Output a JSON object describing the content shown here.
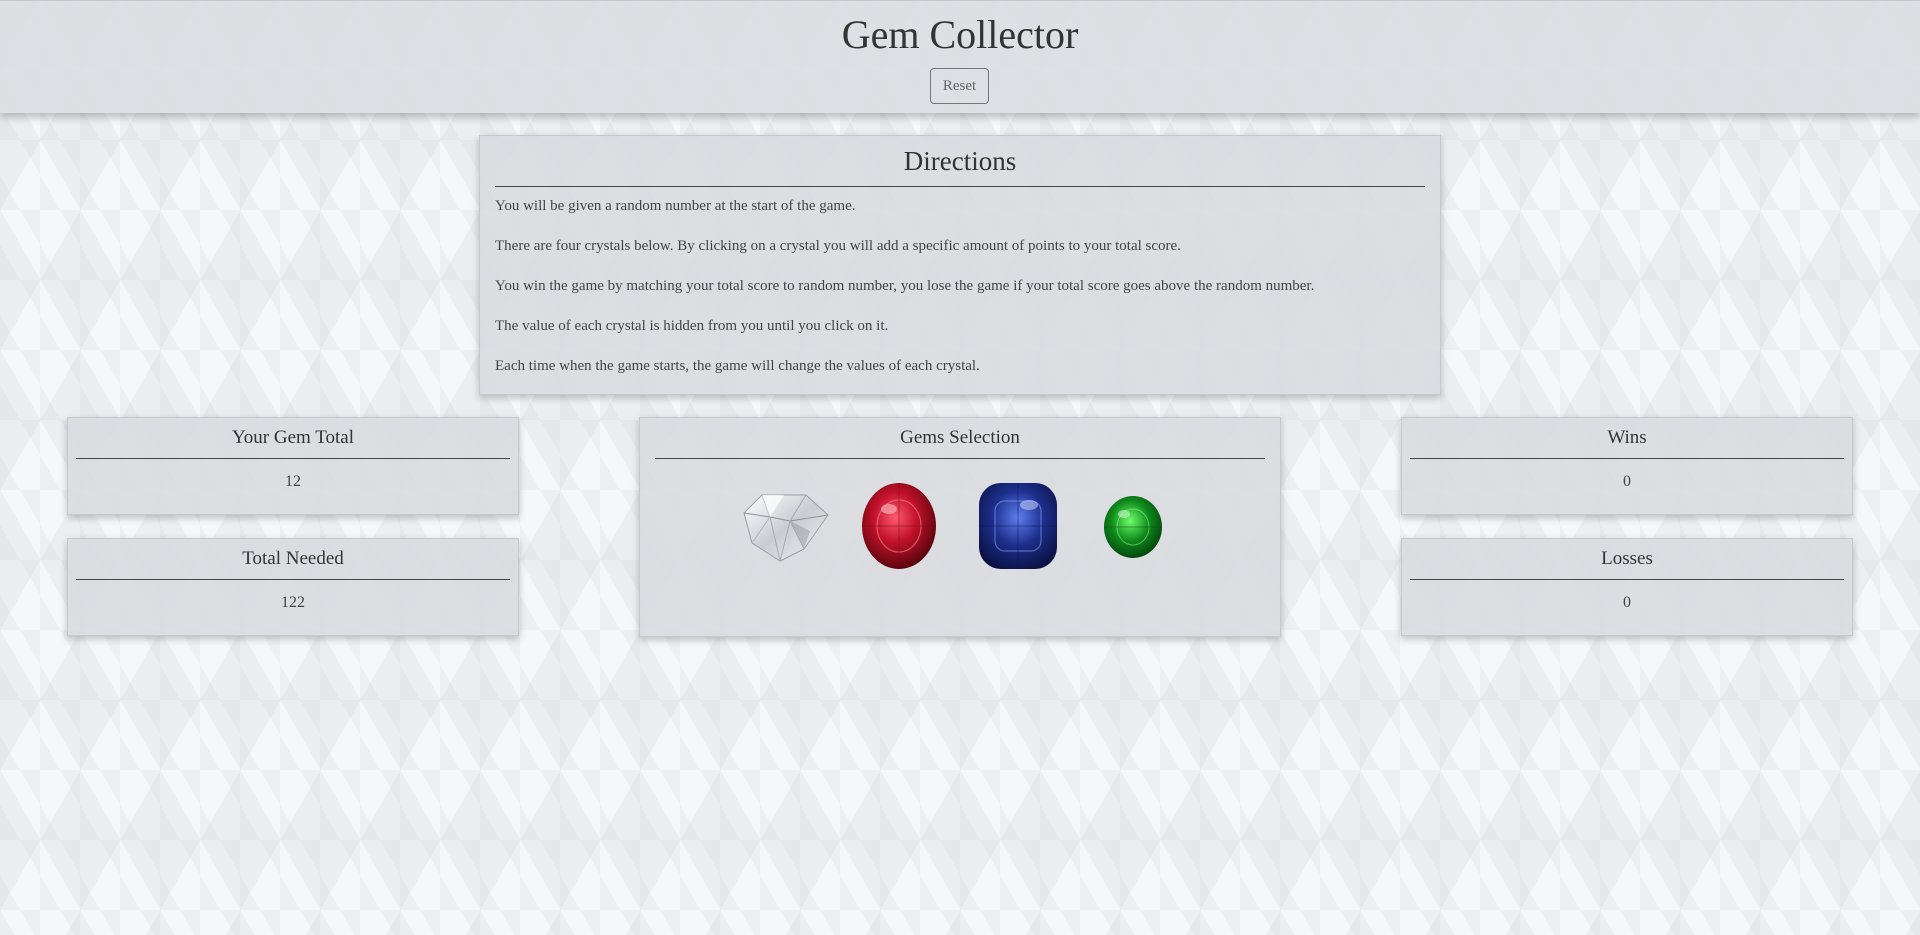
{
  "header": {
    "title": "Gem Collector",
    "reset_label": "Reset"
  },
  "directions": {
    "title": "Directions",
    "lines": [
      "You will be given a random number at the start of the game.",
      "There are four crystals below. By clicking on a crystal you will add a specific amount of points to your total score.",
      "You win the game by matching your total score to random number, you lose the game if your total score goes above the random number.",
      "The value of each crystal is hidden from you until you click on it.",
      "Each time when the game starts, the game will change the values of each crystal."
    ]
  },
  "gem_total": {
    "title": "Your Gem Total",
    "value": "12"
  },
  "total_needed": {
    "title": "Total Needed",
    "value": "122"
  },
  "gems_selection": {
    "title": "Gems Selection",
    "gems": [
      {
        "name": "diamond",
        "color": "#e9ecf0"
      },
      {
        "name": "ruby",
        "color": "#c0112a"
      },
      {
        "name": "sapphire",
        "color": "#1d2f8c"
      },
      {
        "name": "emerald",
        "color": "#0f8a1c"
      }
    ]
  },
  "wins": {
    "title": "Wins",
    "value": "0"
  },
  "losses": {
    "title": "Losses",
    "value": "0"
  }
}
